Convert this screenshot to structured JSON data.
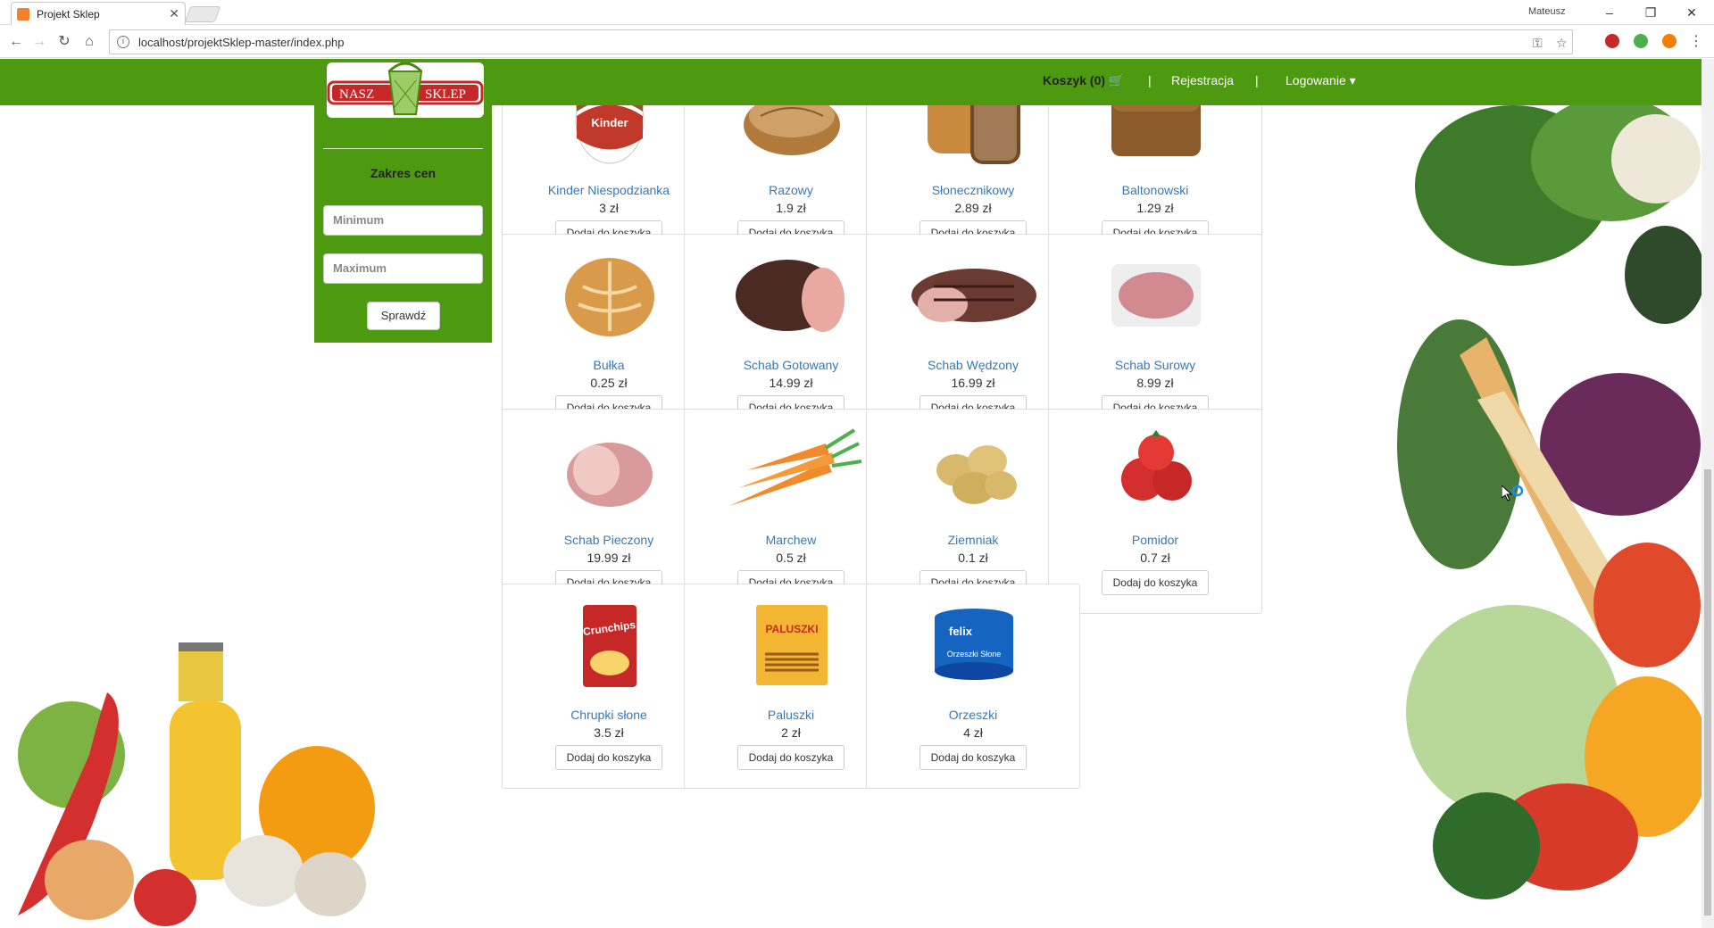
{
  "browser": {
    "tab_title": "Projekt Sklep",
    "user": "Mateusz",
    "url": "localhost/projektSklep-master/index.php"
  },
  "navbar": {
    "logo_left": "NASZ",
    "logo_right": "SKLEP",
    "cart": "Koszyk (0)",
    "separator": "|",
    "register": "Rejestracja",
    "login": "Logowanie"
  },
  "sidebar": {
    "price_heading": "Zakres cen",
    "min_placeholder": "Minimum",
    "max_placeholder": "Maximum",
    "check_button": "Sprawdź"
  },
  "products": [
    {
      "name": "Kinder Niespodzianka",
      "price": "3 zł",
      "button": "Dodaj do koszyka",
      "icon": "kinder-egg"
    },
    {
      "name": "Razowy",
      "price": "1.9 zł",
      "button": "Dodaj do koszyka",
      "icon": "bread-loaf"
    },
    {
      "name": "Słonecznikowy",
      "price": "2.89 zł",
      "button": "Dodaj do koszyka",
      "icon": "sunflower-bread"
    },
    {
      "name": "Baltonowski",
      "price": "1.29 zł",
      "button": "Dodaj do koszyka",
      "icon": "tin-bread"
    },
    {
      "name": "Bułka",
      "price": "0.25 zł",
      "button": "Dodaj do koszyka",
      "icon": "bread-roll"
    },
    {
      "name": "Schab Gotowany",
      "price": "14.99 zł",
      "button": "Dodaj do koszyka",
      "icon": "smoked-ham"
    },
    {
      "name": "Schab Wędzony",
      "price": "16.99 zł",
      "button": "Dodaj do koszyka",
      "icon": "smoked-pork"
    },
    {
      "name": "Schab Surowy",
      "price": "8.99 zł",
      "button": "Dodaj do koszyka",
      "icon": "raw-pork"
    },
    {
      "name": "Schab Pieczony",
      "price": "19.99 zł",
      "button": "Dodaj do koszyka",
      "icon": "roast-pork"
    },
    {
      "name": "Marchew",
      "price": "0.5 zł",
      "button": "Dodaj do koszyka",
      "icon": "carrots"
    },
    {
      "name": "Ziemniak",
      "price": "0.1 zł",
      "button": "Dodaj do koszyka",
      "icon": "potatoes"
    },
    {
      "name": "Pomidor",
      "price": "0.7 zł",
      "button": "Dodaj do koszyka",
      "icon": "tomatoes"
    },
    {
      "name": "Chrupki słone",
      "price": "3.5 zł",
      "button": "Dodaj do koszyka",
      "icon": "chips-bag"
    },
    {
      "name": "Paluszki",
      "price": "2 zł",
      "button": "Dodaj do koszyka",
      "icon": "pretzel-sticks"
    },
    {
      "name": "Orzeszki",
      "price": "4 zł",
      "button": "Dodaj do koszyka",
      "icon": "peanut-can"
    }
  ],
  "product_image_texts": {
    "kinder": "Kinder",
    "chips": "Crunchips",
    "sticks": "PALUSZKI",
    "nuts_brand": "felix",
    "nuts_label": "Orzeszki Słone"
  },
  "colors": {
    "navbar_green": "#4d9a10",
    "link_blue": "#337ab7"
  }
}
